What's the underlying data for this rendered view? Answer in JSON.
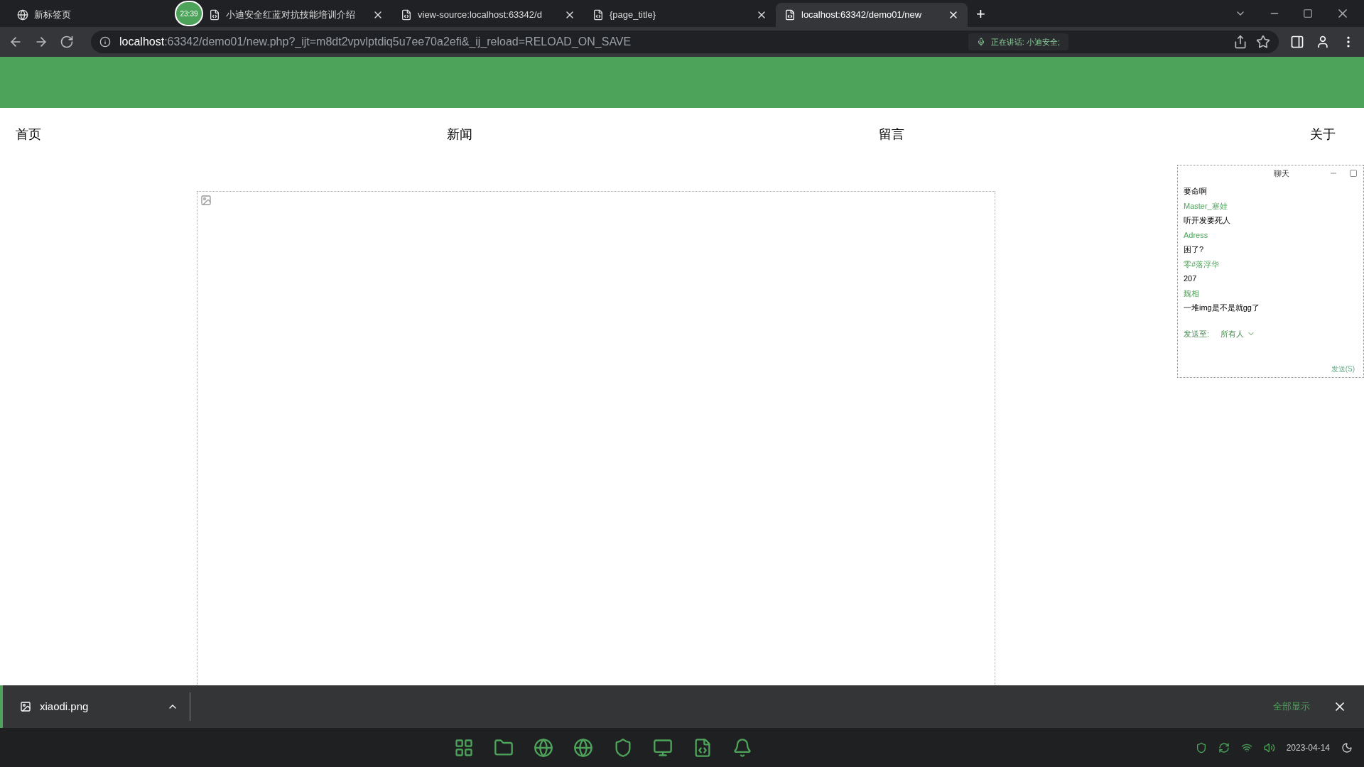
{
  "browser": {
    "tabs": [
      {
        "title": "新标签页",
        "selected": false,
        "closable": false
      },
      {
        "title": "小迪安全红蓝对抗技能培训介绍",
        "selected": false,
        "closable": true
      },
      {
        "title": "view-source:localhost:63342/d",
        "selected": false,
        "closable": true
      },
      {
        "title": "{page_title}",
        "selected": false,
        "closable": true
      },
      {
        "title": "localhost:63342/demo01/new",
        "selected": true,
        "closable": true
      }
    ],
    "new_tab": "+",
    "recording_timer": "23:39",
    "address": {
      "host": "localhost",
      "rest": ":63342/demo01/new.php?_ijt=m8dt2vpvlptdiq5u7ee70a2efi&_ij_reload=RELOAD_ON_SAVE"
    },
    "speaking_indicator": "正在讲话: 小迪安全;"
  },
  "page": {
    "nav": [
      "首页",
      "新闻",
      "留言",
      "关于"
    ]
  },
  "chat": {
    "title": "聊天",
    "messages": [
      {
        "kind": "message",
        "text": "要命啊"
      },
      {
        "kind": "name",
        "text": "Master_塞娃"
      },
      {
        "kind": "message",
        "text": "听开发要死人"
      },
      {
        "kind": "name",
        "text": "Adress"
      },
      {
        "kind": "message",
        "text": "困了?"
      },
      {
        "kind": "name",
        "text": "零#落浮华"
      },
      {
        "kind": "message",
        "text": "207"
      },
      {
        "kind": "name",
        "text": "魏相"
      },
      {
        "kind": "message",
        "text": "一堆img是不是就gg了"
      }
    ],
    "send_to_label": "发送至:",
    "recipient": "所有人",
    "send_button": "发送(S)"
  },
  "downloads": {
    "file": "xiaodi.png",
    "show_all": "全部显示"
  },
  "taskbar": {
    "date": "2023-04-14"
  }
}
